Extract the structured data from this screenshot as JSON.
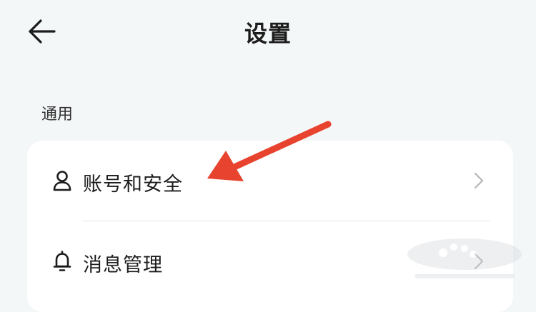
{
  "header": {
    "title": "设置",
    "back_icon": "arrow-left-icon"
  },
  "section": {
    "label": "通用"
  },
  "settings_items": [
    {
      "label": "账号和安全",
      "icon": "user-icon"
    },
    {
      "label": "消息管理",
      "icon": "bell-icon"
    }
  ],
  "annotation": {
    "color": "#e8432f",
    "target": "账号和安全"
  },
  "colors": {
    "background": "#f4f7f8",
    "card": "#ffffff",
    "chevron": "#b5b5b5",
    "text": "#1c1c1c"
  }
}
